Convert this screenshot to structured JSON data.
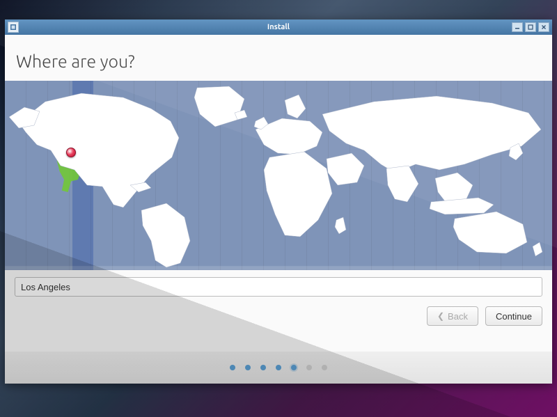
{
  "window": {
    "title": "Install"
  },
  "page": {
    "heading": "Where are you?",
    "location_value": "Los Angeles"
  },
  "buttons": {
    "back": "Back",
    "continue": "Continue"
  },
  "progress": {
    "total": 7,
    "current": 5
  },
  "map": {
    "selected_timezone": "America/Los_Angeles",
    "pin": {
      "city": "Los Angeles"
    }
  },
  "colors": {
    "titlebar_top": "#5a8fbf",
    "titlebar_bottom": "#3b6e9e",
    "map_ocean": "#7f94b8",
    "tz_band": "#5f7ab0",
    "tz_highlight": "#72c63a",
    "dot_active": "#5a9fd4"
  }
}
